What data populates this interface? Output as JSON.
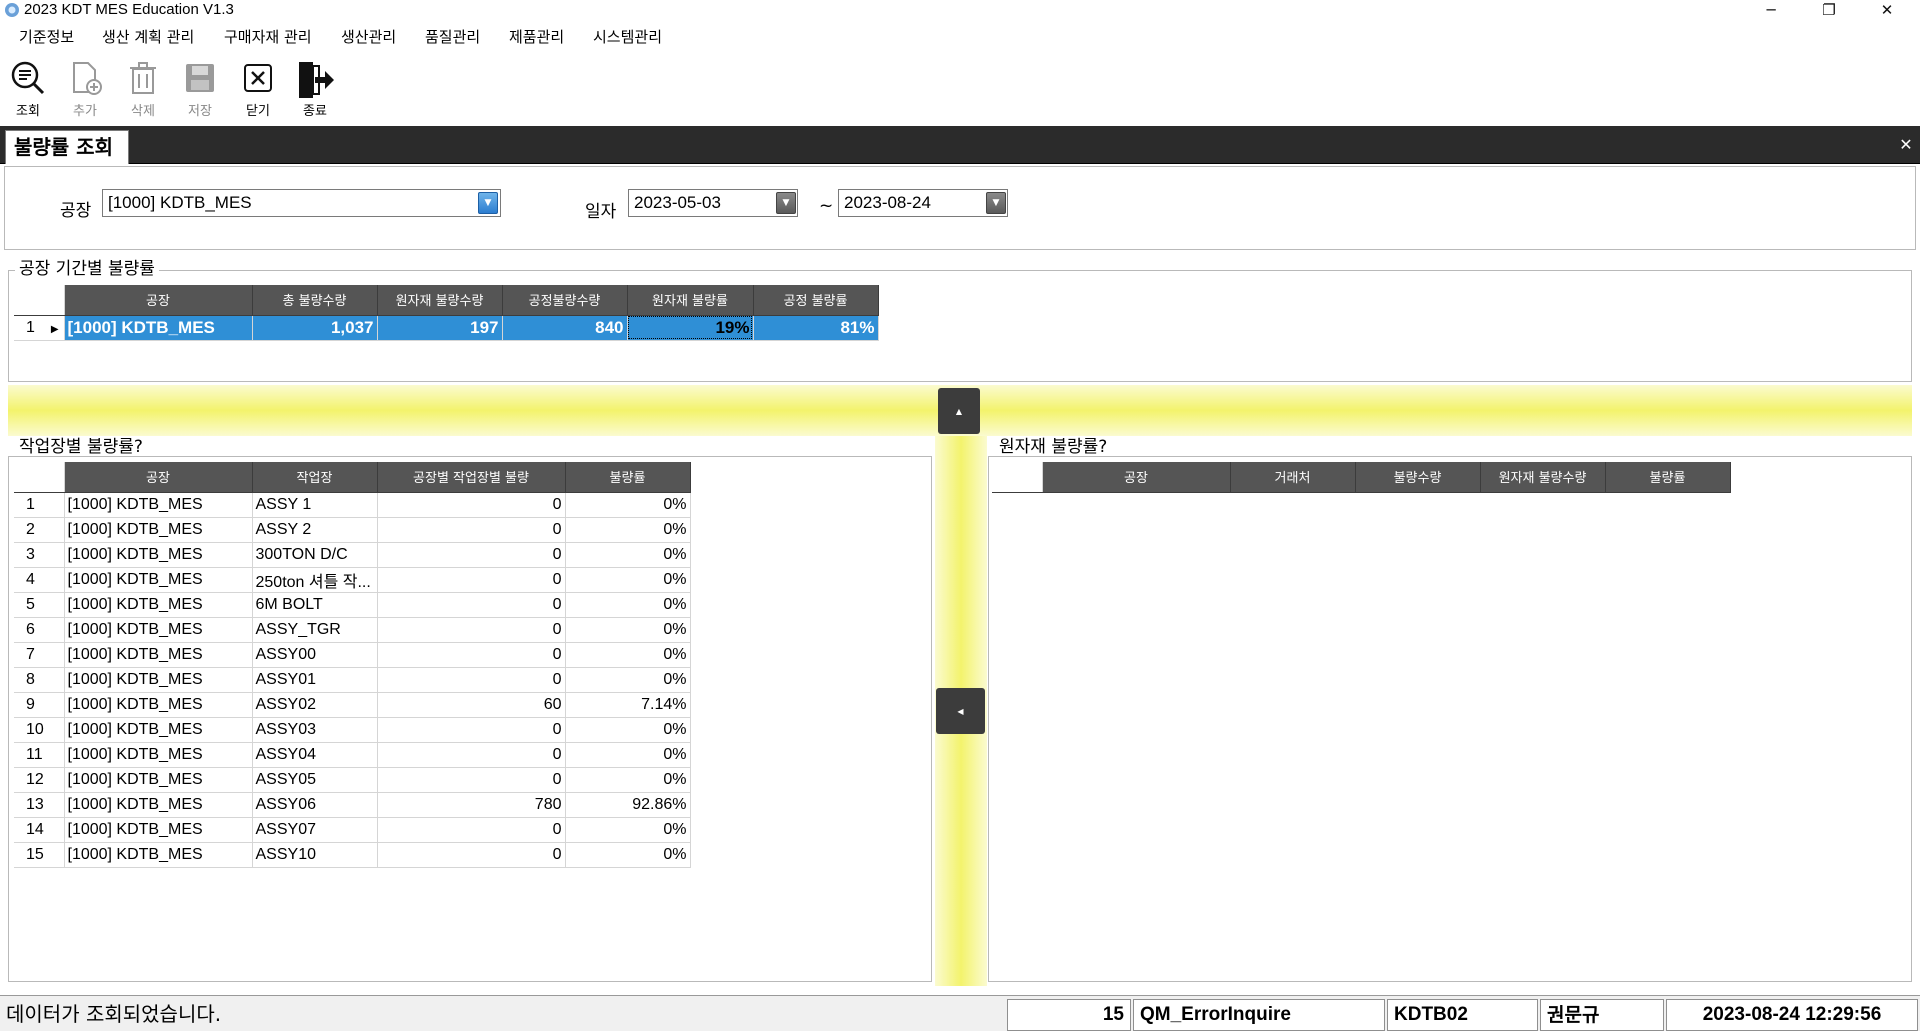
{
  "window": {
    "title": "2023 KDT MES Education V1.3",
    "minimize": "─",
    "restore": "❐",
    "close": "✕"
  },
  "menu": [
    "기준정보",
    "생산 계획 관리",
    "구매자재 관리",
    "생산관리",
    "품질관리",
    "제품관리",
    "시스템관리"
  ],
  "toolbar": {
    "search": "조회",
    "add": "추가",
    "delete": "삭제",
    "save": "저장",
    "close": "닫기",
    "exit": "종료"
  },
  "tab": {
    "label": "불량률 조회",
    "close": "✕"
  },
  "search": {
    "factory_label": "공장",
    "factory_value": "[1000] KDTB_MES",
    "date_label": "일자",
    "date_from": "2023-05-03",
    "date_sep": "~",
    "date_to": "2023-08-24"
  },
  "period_group": {
    "title": "공장 기간별 불량률",
    "columns": [
      "공장",
      "총 불량수량",
      "원자재 불량수량",
      "공정불량수량",
      "원자재 불량률",
      "공정 불량률"
    ],
    "rows": [
      {
        "rn": "1",
        "factory": "[1000] KDTB_MES",
        "total": "1,037",
        "material": "197",
        "process": "840",
        "material_rate": "19%",
        "process_rate": "81%"
      }
    ]
  },
  "workplace_group": {
    "title": "작업장별 불량률?",
    "columns": [
      "공장",
      "작업장",
      "공장별 작업장별 불량",
      "불량률"
    ],
    "rows": [
      {
        "rn": "1",
        "factory": "[1000] KDTB_MES",
        "workplace": "ASSY 1",
        "qty": "0",
        "rate": "0%"
      },
      {
        "rn": "2",
        "factory": "[1000] KDTB_MES",
        "workplace": "ASSY 2",
        "qty": "0",
        "rate": "0%"
      },
      {
        "rn": "3",
        "factory": "[1000] KDTB_MES",
        "workplace": "300TON D/C",
        "qty": "0",
        "rate": "0%"
      },
      {
        "rn": "4",
        "factory": "[1000] KDTB_MES",
        "workplace": "250ton 셔틀 작...",
        "qty": "0",
        "rate": "0%"
      },
      {
        "rn": "5",
        "factory": "[1000] KDTB_MES",
        "workplace": "6M BOLT",
        "qty": "0",
        "rate": "0%"
      },
      {
        "rn": "6",
        "factory": "[1000] KDTB_MES",
        "workplace": "ASSY_TGR",
        "qty": "0",
        "rate": "0%"
      },
      {
        "rn": "7",
        "factory": "[1000] KDTB_MES",
        "workplace": "ASSY00",
        "qty": "0",
        "rate": "0%"
      },
      {
        "rn": "8",
        "factory": "[1000] KDTB_MES",
        "workplace": "ASSY01",
        "qty": "0",
        "rate": "0%"
      },
      {
        "rn": "9",
        "factory": "[1000] KDTB_MES",
        "workplace": "ASSY02",
        "qty": "60",
        "rate": "7.14%"
      },
      {
        "rn": "10",
        "factory": "[1000] KDTB_MES",
        "workplace": "ASSY03",
        "qty": "0",
        "rate": "0%"
      },
      {
        "rn": "11",
        "factory": "[1000] KDTB_MES",
        "workplace": "ASSY04",
        "qty": "0",
        "rate": "0%"
      },
      {
        "rn": "12",
        "factory": "[1000] KDTB_MES",
        "workplace": "ASSY05",
        "qty": "0",
        "rate": "0%"
      },
      {
        "rn": "13",
        "factory": "[1000] KDTB_MES",
        "workplace": "ASSY06",
        "qty": "780",
        "rate": "92.86%"
      },
      {
        "rn": "14",
        "factory": "[1000] KDTB_MES",
        "workplace": "ASSY07",
        "qty": "0",
        "rate": "0%"
      },
      {
        "rn": "15",
        "factory": "[1000] KDTB_MES",
        "workplace": "ASSY10",
        "qty": "0",
        "rate": "0%"
      }
    ]
  },
  "material_group": {
    "title": "원자재 불량률?",
    "columns": [
      "공장",
      "거래처",
      "불량수량",
      "원자재 불량수량",
      "불량률"
    ]
  },
  "statusbar": {
    "message": "데이터가 조회되었습니다.",
    "count": "15",
    "screen": "QM_ErrorInquire",
    "user_id": "KDTB02",
    "user_name": "권문규",
    "datetime": "2023-08-24 12:29:56"
  },
  "colors": {
    "selection": "#2f8fd6",
    "header": "#555555",
    "splitter": "#f3f36c"
  }
}
